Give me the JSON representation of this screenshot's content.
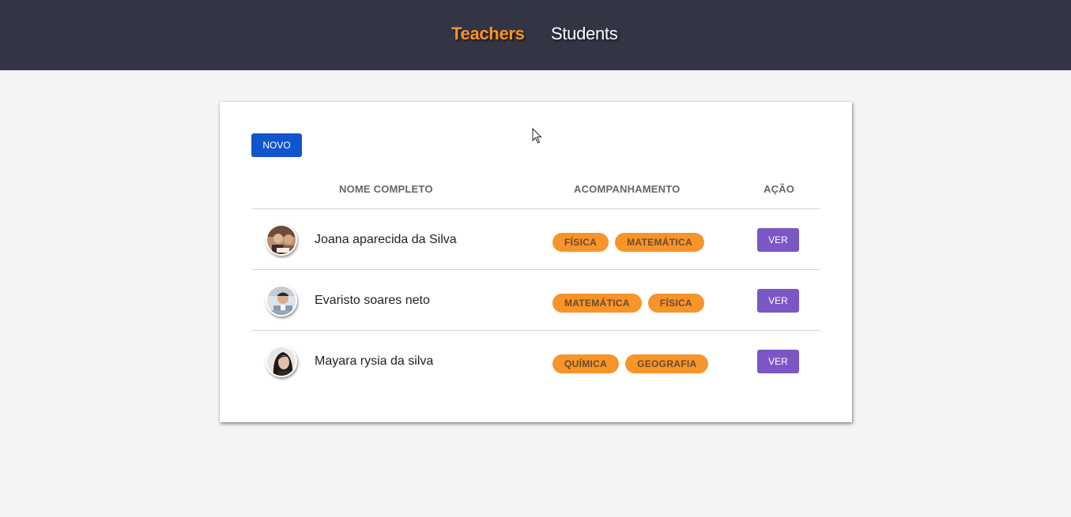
{
  "nav": {
    "teachers_label": "Teachers",
    "students_label": "Students"
  },
  "colors": {
    "topbar": "#333545",
    "accent_orange": "#f7942a",
    "primary_blue": "#1155cc",
    "action_purple": "#7b57c6"
  },
  "toolbar": {
    "new_label": "NOVO"
  },
  "table": {
    "headers": {
      "name": "NOME COMPLETO",
      "tracking": "ACOMPANHAMENTO",
      "action": "AÇÃO"
    },
    "rows": [
      {
        "name": "Joana aparecida da Silva",
        "tags": [
          "FÍSICA",
          "MATEMÁTICA"
        ],
        "action": "VER"
      },
      {
        "name": "Evaristo soares neto",
        "tags": [
          "MATEMÁTICA",
          "FÍSICA"
        ],
        "action": "VER"
      },
      {
        "name": "Mayara rysia da silva",
        "tags": [
          "QUÍMICA",
          "GEOGRAFIA"
        ],
        "action": "VER"
      }
    ]
  }
}
